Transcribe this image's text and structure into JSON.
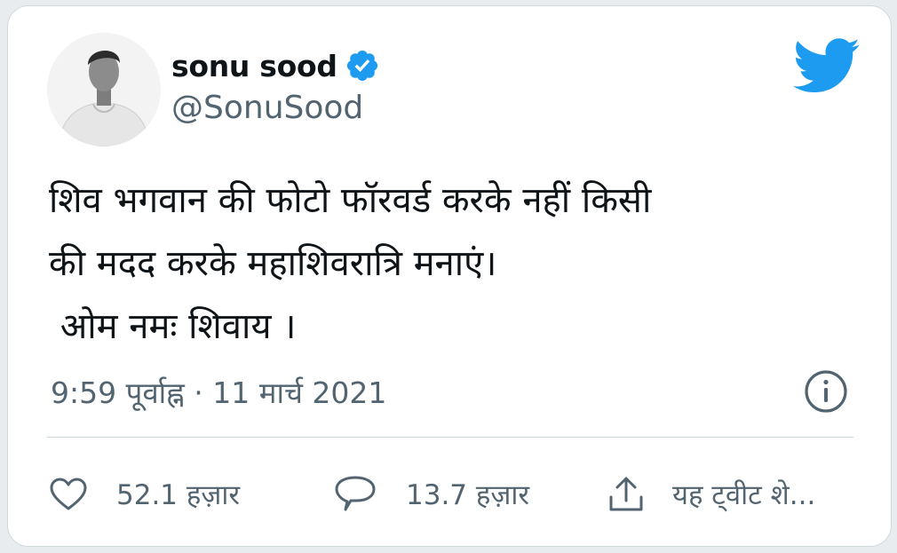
{
  "author": {
    "display_name": "sonu sood",
    "handle": "@SonuSood",
    "verified": true,
    "verified_color": "#1d9bf0"
  },
  "tweet": {
    "lines": [
      "शिव भगवान की फोटो फॉरवर्ड करके नहीं किसी",
      "की मदद करके महाशिवरात्रि मनाएं।",
      " ओम नमः शिवाय ।"
    ],
    "timestamp": "9:59 पूर्वाह्न · 11 मार्च 2021"
  },
  "actions": {
    "likes": "52.1 हज़ार",
    "replies": "13.7 हज़ार",
    "share": "यह ट्वीट शे..."
  },
  "icons": {
    "brand": "twitter-bird-icon",
    "info": "info-icon",
    "like": "heart-icon",
    "reply": "reply-bubble-icon",
    "share": "share-upload-icon"
  },
  "colors": {
    "brand": "#1d9bf0",
    "text": "#0f1419",
    "secondary": "#536471",
    "border": "#cfd9de"
  }
}
